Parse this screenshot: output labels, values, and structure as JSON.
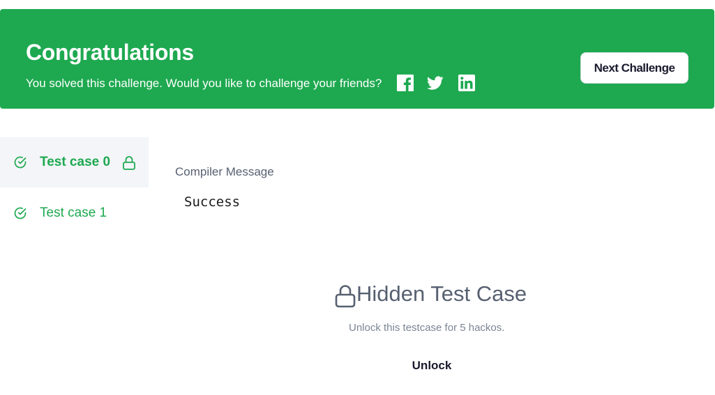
{
  "banner": {
    "title": "Congratulations",
    "subtitle": "You solved this challenge. Would you like to challenge your friends?",
    "share_icons": [
      "facebook-icon",
      "twitter-icon",
      "linkedin-icon"
    ],
    "next_button": "Next Challenge",
    "background_color": "#1ea950"
  },
  "test_cases": [
    {
      "label": "Test case 0",
      "status": "passed",
      "locked": true,
      "selected": true
    },
    {
      "label": "Test case 1",
      "status": "passed",
      "locked": false,
      "selected": false
    }
  ],
  "compiler": {
    "label": "Compiler Message",
    "message": "Success"
  },
  "hidden_case": {
    "title": "Hidden Test Case",
    "description": "Unlock this testcase for 5 hackos.",
    "unlock_button": "Unlock"
  }
}
